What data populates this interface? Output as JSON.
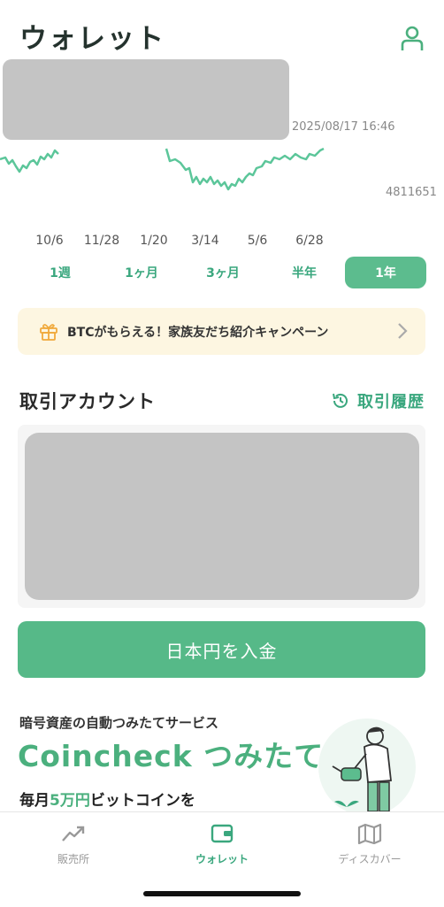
{
  "header": {
    "title": "ウォレット",
    "profile_icon": "person-icon"
  },
  "chart": {
    "timestamp": "2025/08/17 16:46",
    "low_value": "4811651",
    "line_color": "#5cc69a",
    "x_labels": [
      "10/6",
      "11/28",
      "1/20",
      "3/14",
      "5/6",
      "6/28"
    ]
  },
  "period_tabs": [
    {
      "label": "1週",
      "active": false
    },
    {
      "label": "1ヶ月",
      "active": false
    },
    {
      "label": "3ヶ月",
      "active": false
    },
    {
      "label": "半年",
      "active": false
    },
    {
      "label": "1年",
      "active": true
    }
  ],
  "promo": {
    "text": "BTCがもらえる！家族友だち紹介キャンペーン",
    "icon": "gift-icon"
  },
  "account_section": {
    "title": "取引アカウント",
    "history_label": "取引履歴",
    "history_icon": "history-icon"
  },
  "deposit_button": {
    "label": "日本円を入金"
  },
  "tsumitate": {
    "subtitle": "暗号資産の自動つみたてサービス",
    "title": "Coincheck つみたて",
    "desc_prefix": "毎月",
    "desc_amount": "5万円",
    "desc_suffix": "ビットコインを"
  },
  "bottom_nav": [
    {
      "label": "販売所",
      "icon": "trend-icon",
      "active": false
    },
    {
      "label": "ウォレット",
      "icon": "wallet-icon",
      "active": true
    },
    {
      "label": "ディスカバー",
      "icon": "map-icon",
      "active": false
    }
  ],
  "colors": {
    "accent": "#56b988",
    "promo_bg": "#fdf6e1"
  }
}
